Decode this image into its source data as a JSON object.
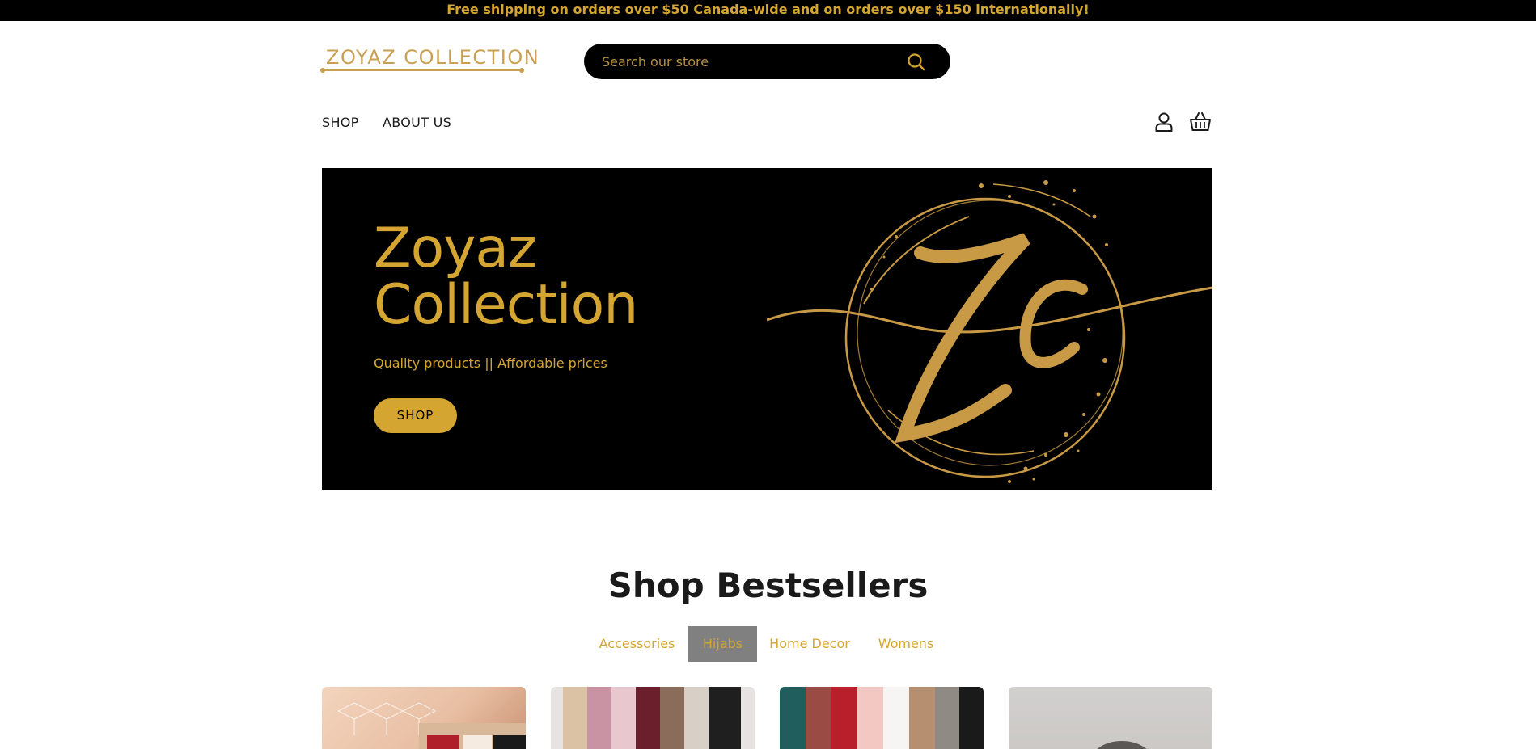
{
  "announcement": "Free shipping on orders over $50 Canada-wide and on orders over $150 internationally!",
  "brand": {
    "logo_text": "ZOYAZ COLLECTION",
    "accent_color": "#d4a531"
  },
  "search": {
    "placeholder": "Search our store",
    "icon": "search-icon"
  },
  "nav": {
    "items": [
      {
        "label": "SHOP"
      },
      {
        "label": "ABOUT US"
      }
    ]
  },
  "header_icons": {
    "account": "user-icon",
    "cart": "basket-icon"
  },
  "hero": {
    "title": "Zoyaz\nCollection",
    "subtitle": "Quality products || Affordable prices",
    "button_label": "SHOP",
    "emblem": "zc-monogram-logo"
  },
  "bestsellers": {
    "title": "Shop Bestsellers",
    "tabs": [
      {
        "label": "Accessories",
        "active": false
      },
      {
        "label": "Hijabs",
        "active": true
      },
      {
        "label": "Home Decor",
        "active": false
      },
      {
        "label": "Womens",
        "active": false
      }
    ],
    "cards": [
      {
        "image": "gift-box-product-image"
      },
      {
        "image": "pastel-hijabs-product-image"
      },
      {
        "image": "assorted-hijabs-product-image"
      },
      {
        "image": "gray-product-image"
      }
    ]
  }
}
